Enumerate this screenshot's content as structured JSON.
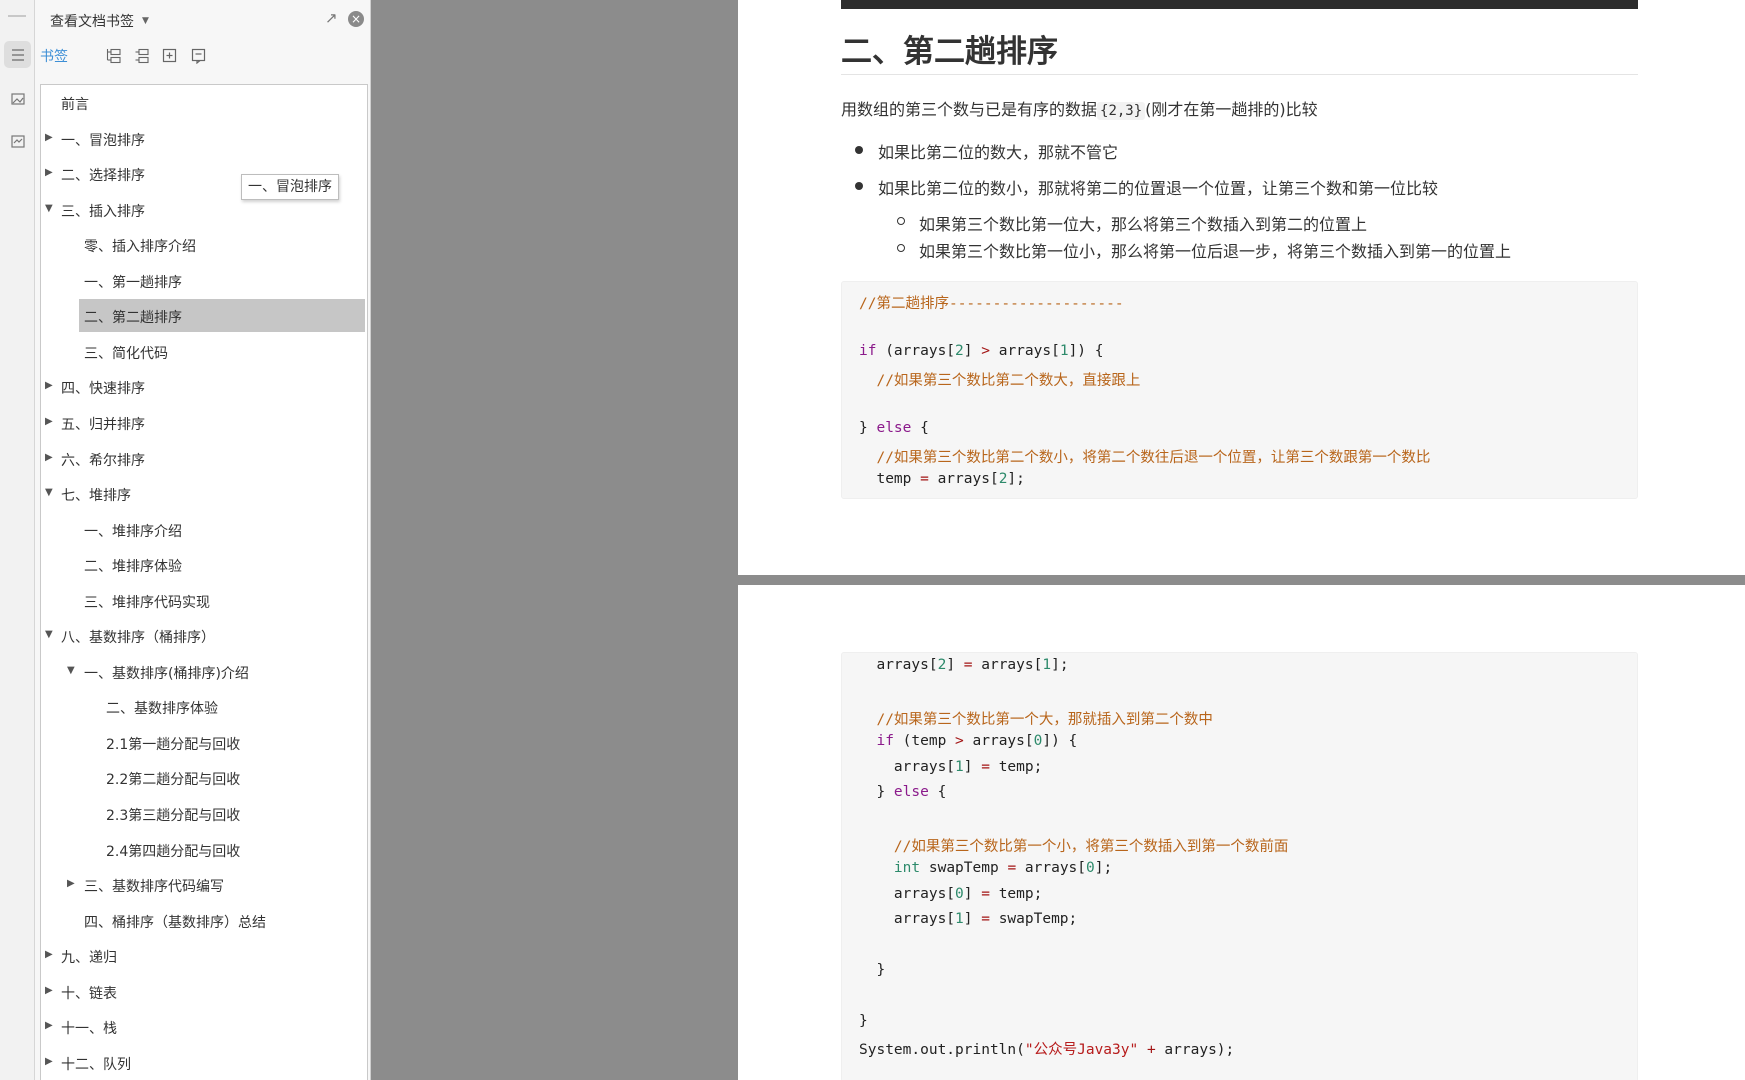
{
  "panel": {
    "title": "查看文档书签",
    "bookmark_tab": "书签"
  },
  "tooltip": "一、冒泡排序",
  "tree": [
    {
      "label": "前言",
      "level": 0,
      "expander": "none"
    },
    {
      "label": "一、冒泡排序",
      "level": 0,
      "expander": "collapsed"
    },
    {
      "label": "二、选择排序",
      "level": 0,
      "expander": "collapsed"
    },
    {
      "label": "三、插入排序",
      "level": 0,
      "expander": "expanded"
    },
    {
      "label": "零、插入排序介绍",
      "level": 1,
      "expander": "none"
    },
    {
      "label": "一、第一趟排序",
      "level": 1,
      "expander": "none"
    },
    {
      "label": "二、第二趟排序",
      "level": 1,
      "expander": "none",
      "selected": true
    },
    {
      "label": "三、简化代码",
      "level": 1,
      "expander": "none"
    },
    {
      "label": "四、快速排序",
      "level": 0,
      "expander": "collapsed"
    },
    {
      "label": "五、归并排序",
      "level": 0,
      "expander": "collapsed"
    },
    {
      "label": "六、希尔排序",
      "level": 0,
      "expander": "collapsed"
    },
    {
      "label": "七、堆排序",
      "level": 0,
      "expander": "expanded"
    },
    {
      "label": "一、堆排序介绍",
      "level": 1,
      "expander": "none"
    },
    {
      "label": "二、堆排序体验",
      "level": 1,
      "expander": "none"
    },
    {
      "label": "三、堆排序代码实现",
      "level": 1,
      "expander": "none"
    },
    {
      "label": "八、基数排序（桶排序）",
      "level": 0,
      "expander": "expanded"
    },
    {
      "label": "一、基数排序(桶排序)介绍",
      "level": 1,
      "expander": "expanded"
    },
    {
      "label": "二、基数排序体验",
      "level": 2,
      "expander": "none"
    },
    {
      "label": "2.1第一趟分配与回收",
      "level": 2,
      "expander": "none"
    },
    {
      "label": "2.2第二趟分配与回收",
      "level": 2,
      "expander": "none"
    },
    {
      "label": "2.3第三趟分配与回收",
      "level": 2,
      "expander": "none"
    },
    {
      "label": "2.4第四趟分配与回收",
      "level": 2,
      "expander": "none"
    },
    {
      "label": "三、基数排序代码编写",
      "level": 1,
      "expander": "collapsed"
    },
    {
      "label": "四、桶排序（基数排序）总结",
      "level": 1,
      "expander": "none"
    },
    {
      "label": "九、递归",
      "level": 0,
      "expander": "collapsed"
    },
    {
      "label": "十、链表",
      "level": 0,
      "expander": "collapsed"
    },
    {
      "label": "十一、栈",
      "level": 0,
      "expander": "collapsed"
    },
    {
      "label": "十二、队列",
      "level": 0,
      "expander": "collapsed"
    }
  ],
  "doc": {
    "heading": "二、第二趟排序",
    "intro_before": "用数组的第三个数与已是有序的数据",
    "intro_code": "{2,3}",
    "intro_after": "(刚才在第一趟排的)比较",
    "bullets": [
      "如果比第二位的数大，那就不管它",
      "如果比第二位的数小，那就将第二的位置退一个位置，让第三个数和第一位比较"
    ],
    "sub_bullets": [
      "如果第三个数比第一位大，那么将第三个数插入到第二的位置上",
      "如果第三个数比第一位小，那么将第一位后退一步，将第三个数插入到第一的位置上"
    ],
    "code1": [
      [
        [
          "c-comment",
          "//第二趟排序--------------------"
        ]
      ],
      [],
      [
        [
          "c-kw",
          "if"
        ],
        [
          "",
          " (arrays["
        ],
        [
          "c-num",
          "2"
        ],
        [
          "",
          "] "
        ],
        [
          "c-op",
          ">"
        ],
        [
          "",
          " arrays["
        ],
        [
          "c-num",
          "1"
        ],
        [
          "",
          "]) {"
        ]
      ],
      [
        [
          "c-comment",
          "  //如果第三个数比第二个数大，直接跟上"
        ]
      ],
      [],
      [
        [
          "",
          "} "
        ],
        [
          "c-kw",
          "else"
        ],
        [
          "",
          " {"
        ]
      ],
      [
        [
          "c-comment",
          "  //如果第三个数比第二个数小，将第二个数往后退一个位置，让第三个数跟第一个数比"
        ]
      ],
      [
        [
          "",
          "  temp "
        ],
        [
          "c-op",
          "="
        ],
        [
          "",
          " arrays["
        ],
        [
          "c-num",
          "2"
        ],
        [
          "",
          "];"
        ]
      ]
    ],
    "code2": [
      [
        [
          "",
          "  arrays["
        ],
        [
          "c-num",
          "2"
        ],
        [
          "",
          "] "
        ],
        [
          "c-op",
          "="
        ],
        [
          "",
          " arrays["
        ],
        [
          "c-num",
          "1"
        ],
        [
          "",
          "];"
        ]
      ],
      [],
      [
        [
          "c-comment",
          "  //如果第三个数比第一个大，那就插入到第二个数中"
        ]
      ],
      [
        [
          "",
          "  "
        ],
        [
          "c-kw",
          "if"
        ],
        [
          "",
          " (temp "
        ],
        [
          "c-op",
          ">"
        ],
        [
          "",
          " arrays["
        ],
        [
          "c-num",
          "0"
        ],
        [
          "",
          "]) {"
        ]
      ],
      [
        [
          "",
          "    arrays["
        ],
        [
          "c-num",
          "1"
        ],
        [
          "",
          "] "
        ],
        [
          "c-op",
          "="
        ],
        [
          "",
          " temp;"
        ]
      ],
      [
        [
          "",
          "  } "
        ],
        [
          "c-kw",
          "else"
        ],
        [
          "",
          " {"
        ]
      ],
      [],
      [
        [
          "c-comment",
          "    //如果第三个数比第一个小，将第三个数插入到第一个数前面"
        ]
      ],
      [
        [
          "",
          "    "
        ],
        [
          "c-type",
          "int"
        ],
        [
          "",
          " swapTemp "
        ],
        [
          "c-op",
          "="
        ],
        [
          "",
          " arrays["
        ],
        [
          "c-num",
          "0"
        ],
        [
          "",
          "];"
        ]
      ],
      [
        [
          "",
          "    arrays["
        ],
        [
          "c-num",
          "0"
        ],
        [
          "",
          "] "
        ],
        [
          "c-op",
          "="
        ],
        [
          "",
          " temp;"
        ]
      ],
      [
        [
          "",
          "    arrays["
        ],
        [
          "c-num",
          "1"
        ],
        [
          "",
          "] "
        ],
        [
          "c-op",
          "="
        ],
        [
          "",
          " swapTemp;"
        ]
      ],
      [],
      [
        [
          "",
          "  }"
        ]
      ],
      [],
      [
        [
          "",
          "}"
        ]
      ],
      [
        [
          "",
          "System.out.println("
        ],
        [
          "c-str",
          "\"公众号Java3y\""
        ],
        [
          "",
          " "
        ],
        [
          "c-op",
          "+"
        ],
        [
          "",
          " arrays);"
        ]
      ]
    ]
  }
}
